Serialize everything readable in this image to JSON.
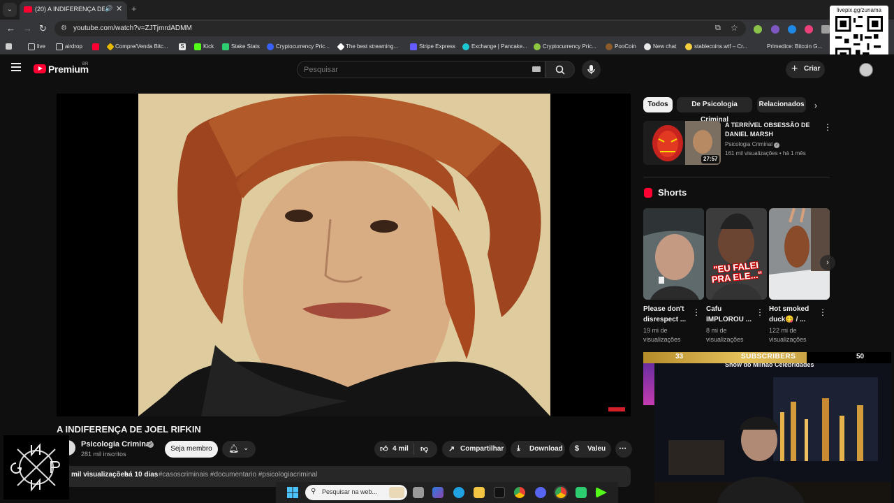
{
  "browser": {
    "tab_title": "(20) A INDIFERENÇA DE JO...",
    "url": "youtube.com/watch?v=ZJTjmrdADMM",
    "bookmarks": [
      {
        "label": "live",
        "color": "#9aa0a6"
      },
      {
        "label": "airdrop",
        "color": "#9aa0a6"
      },
      {
        "label": "",
        "color": "#ff0033"
      },
      {
        "label": "Compre/Venda Bitc...",
        "color": "#e7b800"
      },
      {
        "label": "",
        "color": "#e8e8e8"
      },
      {
        "label": "Kick",
        "color": "#53fc18"
      },
      {
        "label": "Stake Stats",
        "color": "#2ecc71"
      },
      {
        "label": "Cryptocurrency Pric...",
        "color": "#3861fb"
      },
      {
        "label": "The best streaming...",
        "color": "#ffffff"
      },
      {
        "label": "Stripe Express",
        "color": "#635bff"
      },
      {
        "label": "Exchange | Pancake...",
        "color": "#1fc7d4"
      },
      {
        "label": "Cryptocurrency Pric...",
        "color": "#8dc63f"
      },
      {
        "label": "PooCoin",
        "color": "#8b5a2b"
      },
      {
        "label": "New chat",
        "color": "#e8e8e8"
      },
      {
        "label": "stablecoins.wtf – Cr...",
        "color": "#f4d03f"
      },
      {
        "label": "Primedice: Bitcoin G...",
        "color": "#9aa0a6"
      }
    ]
  },
  "overlay": {
    "qr_label": "livepix.gg/zunama",
    "subscriber_goal": {
      "current": "33",
      "label": "SUBSCRIBERS",
      "goal": "50",
      "progress": 0.66
    }
  },
  "youtube": {
    "logo_text": "Premium",
    "logo_country": "BR",
    "search_placeholder": "Pesquisar",
    "create_label": "Criar",
    "video": {
      "title": "A INDIFERENÇA DE JOEL RIFKIN",
      "channel": "Psicologia Criminal",
      "subscribers": "281 mil inscritos",
      "join_label": "Seja membro",
      "likes": "4 mil",
      "share_label": "Compartilhar",
      "download_label": "Download",
      "thanks_label": "Valeu",
      "views": "mil visualizações",
      "age": "há 10 dias",
      "tags": "#casoscriminais #documentario #psicologiacriminal"
    },
    "chips": [
      "Todos",
      "De Psicologia Criminal",
      "Relacionados"
    ],
    "recommendation": {
      "title": "A TERRÍVEL OBSESSÃO DE DANIEL MARSH",
      "channel": "Psicologia Criminal",
      "meta": "161 mil visualizações • há 1 mês",
      "duration": "27:57"
    },
    "shorts_heading": "Shorts",
    "shorts": [
      {
        "title": "Please don't disrespect ...",
        "views": "19 mi de visualizações"
      },
      {
        "title": "Cafu IMPLOROU ...",
        "views": "8 mi de visualizações",
        "caption": "\"EU FALEI PRA ELE...\""
      },
      {
        "title": "Hot smoked duck😋 / ...",
        "views": "122 mi de visualizações"
      }
    ],
    "partial_next_title": "Show do Milhão Celebridades"
  },
  "taskbar": {
    "search_placeholder": "Pesquisar na web..."
  }
}
